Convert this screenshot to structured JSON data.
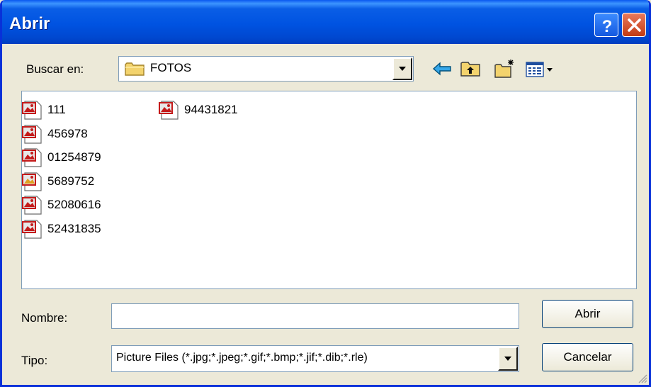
{
  "window": {
    "title": "Abrir"
  },
  "toolbar": {
    "look_in_label": "Buscar en:",
    "current_folder": "FOTOS",
    "folder_icon": "folder-icon",
    "back_icon": "back-arrow-icon",
    "up_icon": "up-one-level-icon",
    "new_folder_icon": "new-folder-icon",
    "view_menu_icon": "view-menu-icon"
  },
  "files": [
    {
      "name": "111",
      "icon": "image-file-icon"
    },
    {
      "name": "456978",
      "icon": "image-file-icon"
    },
    {
      "name": "01254879",
      "icon": "image-file-icon"
    },
    {
      "name": "5689752",
      "icon": "image-file-icon"
    },
    {
      "name": "52080616",
      "icon": "image-file-icon"
    },
    {
      "name": "52431835",
      "icon": "image-file-icon"
    },
    {
      "name": "94431821",
      "icon": "image-file-icon"
    }
  ],
  "form": {
    "name_label": "Nombre:",
    "name_value": "",
    "type_label": "Tipo:",
    "type_value": "Picture Files (*.jpg;*.jpeg;*.gif;*.bmp;*.jif;*.dib;*.rle)"
  },
  "buttons": {
    "open": "Abrir",
    "cancel": "Cancelar"
  },
  "colors": {
    "title_bar": "#0054e3",
    "close_button": "#d5492a",
    "background": "#ece9d8"
  }
}
